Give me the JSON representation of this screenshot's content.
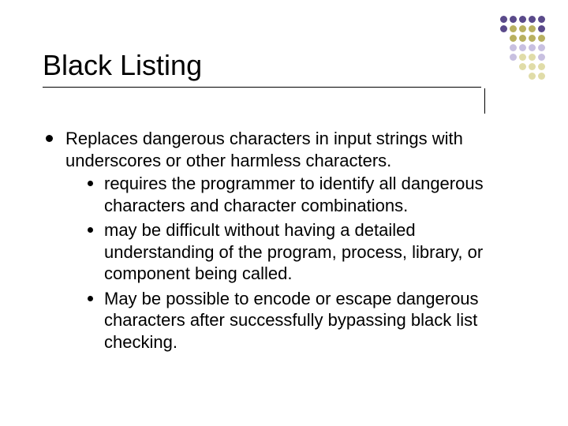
{
  "title": "Black Listing",
  "bullets": [
    {
      "text": "Replaces dangerous characters in input strings with underscores or other harmless characters.",
      "sub": [
        "requires the programmer to identify all dangerous characters and character combinations.",
        "may be difficult without having a detailed understanding of the program, process, library, or component being called.",
        "May be possible to encode or escape dangerous characters after successfully bypassing black list checking."
      ]
    }
  ],
  "deco": {
    "colors": {
      "purple": "#5a4a8a",
      "olive": "#b8b060",
      "ltpur": "#c8c0e0",
      "ltolv": "#e0dca8"
    },
    "rows": [
      [
        "purple",
        "purple",
        "purple",
        "purple",
        "purple"
      ],
      [
        "purple",
        "olive",
        "olive",
        "olive",
        "purple"
      ],
      [
        "olive",
        "olive",
        "olive",
        "olive"
      ],
      [
        "ltpur",
        "ltpur",
        "ltpur",
        "ltpur"
      ],
      [
        "ltpur",
        "ltolv",
        "ltolv",
        "ltpur"
      ],
      [
        "ltolv",
        "ltolv",
        "ltolv"
      ],
      [
        "ltolv",
        "ltolv"
      ]
    ]
  }
}
